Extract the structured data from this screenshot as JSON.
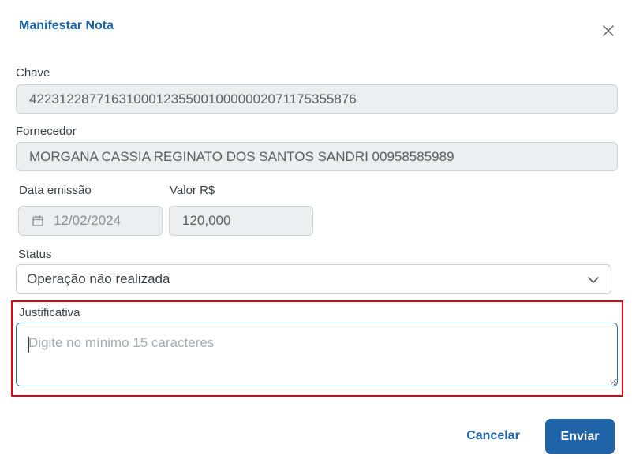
{
  "dialog": {
    "title": "Manifestar Nota",
    "close_icon": "close-icon"
  },
  "chave": {
    "label": "Chave",
    "value": "42231228771631000123550010000002071175355876"
  },
  "fornecedor": {
    "label": "Fornecedor",
    "value": "MORGANA CASSIA REGINATO DOS SANTOS SANDRI 00958585989"
  },
  "data_emissao": {
    "label": "Data emissão",
    "value": "12/02/2024",
    "icon": "calendar-icon"
  },
  "valor": {
    "label": "Valor R$",
    "value": "120,000"
  },
  "status": {
    "label": "Status",
    "selected": "Operação não realizada",
    "icon": "chevron-down-icon"
  },
  "justificativa": {
    "label": "Justificativa",
    "placeholder": "Digite no mínimo 15 caracteres",
    "highlight_color": "#e3000f"
  },
  "actions": {
    "cancel_label": "Cancelar",
    "submit_label": "Enviar"
  },
  "colors": {
    "accent": "#1f63a8",
    "disabled_bg": "#eceeef"
  }
}
